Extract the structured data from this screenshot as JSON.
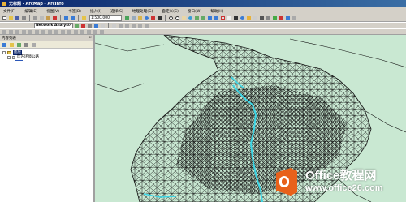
{
  "window": {
    "title": "无标题 - ArcMap - ArcInfo"
  },
  "menu": [
    "文件(F)",
    "编辑(E)",
    "视图(V)",
    "书签(B)",
    "插入(I)",
    "选择(S)",
    "地理处理(G)",
    "自定义(C)",
    "窗口(W)",
    "帮助(H)"
  ],
  "toolbar": {
    "scale_value": "1:500,000",
    "network_analyst_label": "Network Analyst▾"
  },
  "toc": {
    "title": "内容列表",
    "close_glyph": "×",
    "layers_label": "图层",
    "layer_name": "区内环境公路"
  },
  "watermark": {
    "line1": "Office教程网",
    "line2": "www.office26.com"
  },
  "colors": {
    "title_start": "#0a246a",
    "title_end": "#3a6ea5",
    "map_bg": "#c9e8d2",
    "road": "#111111",
    "river": "#3cd6e6",
    "watermark_orange": "#e8611a"
  }
}
